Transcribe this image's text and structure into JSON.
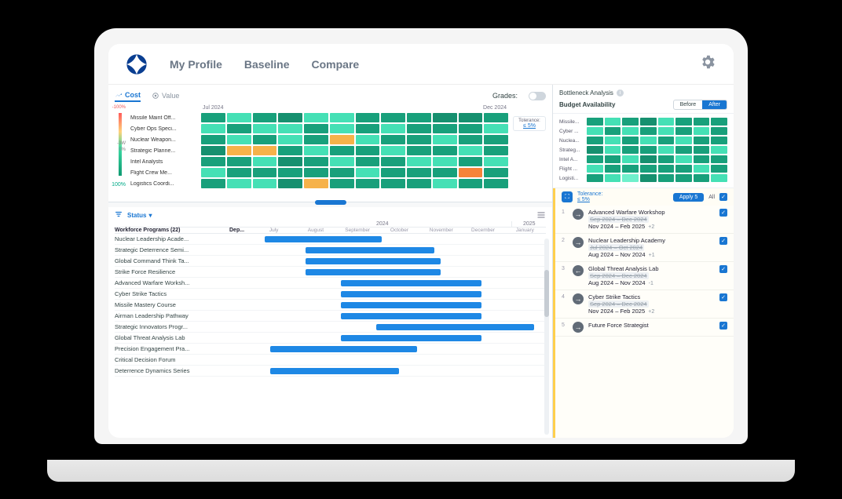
{
  "nav": {
    "links": [
      "My Profile",
      "Baseline",
      "Compare"
    ]
  },
  "tabs": {
    "cost": "Cost",
    "value": "Value",
    "grades_label": "Grades:"
  },
  "heatmap": {
    "start_month": "Jul 2024",
    "end_month": "Dec 2024",
    "scale": {
      "top": "-100%",
      "mid": "-3W",
      "zero": "0%",
      "bottom": "100%"
    },
    "tolerance_label": "Tolerance:",
    "tolerance_value": "≤ 5%",
    "rows": [
      {
        "label": "Missile Maint Off...",
        "cells": [
          "#18a07b",
          "#45e0b5",
          "#18a07b",
          "#16906f",
          "#45e0b5",
          "#45e0b5",
          "#18a07b",
          "#18a07b",
          "#18a07b",
          "#16906f",
          "#16906f",
          "#18a07b"
        ]
      },
      {
        "label": "Cyber Ops Speci...",
        "cells": [
          "#45e0b5",
          "#18a07b",
          "#45e0b5",
          "#45e0b5",
          "#18a07b",
          "#45e0b5",
          "#18a07b",
          "#45e0b5",
          "#18a07b",
          "#18a07b",
          "#18a07b",
          "#45e0b5"
        ]
      },
      {
        "label": "Nuclear Weapon...",
        "cells": [
          "#18a07b",
          "#45e0b5",
          "#18a07b",
          "#45e0b5",
          "#18a07b",
          "#f6b24a",
          "#45e0b5",
          "#18a07b",
          "#18a07b",
          "#45e0b5",
          "#18a07b",
          "#18a07b"
        ]
      },
      {
        "label": "Strategic Planne...",
        "cells": [
          "#16906f",
          "#f6b24a",
          "#f6b24a",
          "#18a07b",
          "#45e0b5",
          "#18a07b",
          "#18a07b",
          "#45e0b5",
          "#18a07b",
          "#18a07b",
          "#45e0b5",
          "#18a07b"
        ]
      },
      {
        "label": "Intel Analysts",
        "cells": [
          "#18a07b",
          "#18a07b",
          "#45e0b5",
          "#16906f",
          "#18a07b",
          "#45e0b5",
          "#18a07b",
          "#18a07b",
          "#45e0b5",
          "#45e0b5",
          "#18a07b",
          "#45e0b5"
        ]
      },
      {
        "label": "Flight Crew Me...",
        "cells": [
          "#45e0b5",
          "#18a07b",
          "#18a07b",
          "#18a07b",
          "#18a07b",
          "#18a07b",
          "#45e0b5",
          "#18a07b",
          "#18a07b",
          "#18a07b",
          "#f6833a",
          "#18a07b"
        ]
      },
      {
        "label": "Logistics Coordi...",
        "cells": [
          "#18a07b",
          "#45e0b5",
          "#45e0b5",
          "#16906f",
          "#f6b24a",
          "#18a07b",
          "#18a07b",
          "#18a07b",
          "#18a07b",
          "#45e0b5",
          "#18a07b",
          "#18a07b"
        ]
      }
    ]
  },
  "gantt": {
    "status_label": "Status",
    "year_a": "2024",
    "year_b": "2025",
    "header_programs": "Workforce Programs (22)",
    "header_dep": "Dep...",
    "months": [
      "July",
      "August",
      "September",
      "October",
      "November",
      "December",
      "January"
    ],
    "rows": [
      {
        "name": "Nuclear Leadership Acade...",
        "start": 4,
        "end": 44
      },
      {
        "name": "Strategic Deterrence Semi...",
        "start": 18,
        "end": 62
      },
      {
        "name": "Global Command Think Ta...",
        "start": 18,
        "end": 64
      },
      {
        "name": "Strike Force Resilience",
        "start": 18,
        "end": 64
      },
      {
        "name": "Advanced Warfare Worksh...",
        "start": 30,
        "end": 78
      },
      {
        "name": "Cyber Strike Tactics",
        "start": 30,
        "end": 78
      },
      {
        "name": "Missile Mastery Course",
        "start": 30,
        "end": 78
      },
      {
        "name": "Airman Leadership Pathway",
        "start": 30,
        "end": 78
      },
      {
        "name": "Strategic Innovators Progr...",
        "start": 42,
        "end": 96
      },
      {
        "name": "Global Threat Analysis Lab",
        "start": 30,
        "end": 78
      },
      {
        "name": "Precision Engagement Pra...",
        "start": 6,
        "end": 56
      },
      {
        "name": "Critical Decision Forum",
        "start": 0,
        "end": 0
      },
      {
        "name": "Deterrence Dynamics Series",
        "start": 6,
        "end": 50
      }
    ]
  },
  "side": {
    "title": "Bottleneck Analysis",
    "budget_label": "Budget Availability",
    "seg_before": "Before",
    "seg_after": "After",
    "mini_rows": [
      {
        "label": "Missile...",
        "cells": [
          "#18a07b",
          "#45e0b5",
          "#18a07b",
          "#16906f",
          "#45e0b5",
          "#18a07b",
          "#18a07b",
          "#18a07b"
        ]
      },
      {
        "label": "Cyber ...",
        "cells": [
          "#45e0b5",
          "#18a07b",
          "#45e0b5",
          "#18a07b",
          "#45e0b5",
          "#18a07b",
          "#45e0b5",
          "#18a07b"
        ]
      },
      {
        "label": "Nuclea...",
        "cells": [
          "#18a07b",
          "#45e0b5",
          "#18a07b",
          "#45e0b5",
          "#18a07b",
          "#45e0b5",
          "#18a07b",
          "#18a07b"
        ]
      },
      {
        "label": "Strateg...",
        "cells": [
          "#16906f",
          "#45e0b5",
          "#18a07b",
          "#18a07b",
          "#45e0b5",
          "#18a07b",
          "#18a07b",
          "#45e0b5"
        ]
      },
      {
        "label": "Intel A...",
        "cells": [
          "#18a07b",
          "#18a07b",
          "#45e0b5",
          "#16906f",
          "#18a07b",
          "#45e0b5",
          "#18a07b",
          "#18a07b"
        ]
      },
      {
        "label": "Flight ...",
        "cells": [
          "#45e0b5",
          "#18a07b",
          "#18a07b",
          "#18a07b",
          "#18a07b",
          "#18a07b",
          "#45e0b5",
          "#18a07b"
        ]
      },
      {
        "label": "Logisti...",
        "cells": [
          "#18a07b",
          "#45e0b5",
          "#6ff0cc",
          "#16906f",
          "#18a07b",
          "#18a07b",
          "#18a07b",
          "#45e0b5"
        ]
      }
    ],
    "rec_head": {
      "tolerance_label": "Tolerance:",
      "tolerance_value": "≤ 5%",
      "apply": "Apply 5",
      "all": "All"
    },
    "recs": [
      {
        "n": "1",
        "dir": "fwd",
        "title": "Advanced Warfare Workshop",
        "old": "Sep 2024 – Dec 2024",
        "new": "Nov 2024 – Feb 2025",
        "delta": "+2"
      },
      {
        "n": "2",
        "dir": "fwd",
        "title": "Nuclear Leadership Academy",
        "old": "Jul 2024 – Oct 2024",
        "new": "Aug 2024 – Nov 2024",
        "delta": "+1"
      },
      {
        "n": "3",
        "dir": "back",
        "title": "Global Threat Analysis Lab",
        "old": "Sep 2024 – Dec 2024",
        "new": "Aug 2024 – Nov 2024",
        "delta": "-1"
      },
      {
        "n": "4",
        "dir": "fwd",
        "title": "Cyber Strike Tactics",
        "old": "Sep 2024 – Dec 2024",
        "new": "Nov 2024 – Feb 2025",
        "delta": "+2"
      },
      {
        "n": "5",
        "dir": "fwd",
        "title": "Future Force Strategist",
        "old": "",
        "new": "",
        "delta": ""
      }
    ]
  }
}
